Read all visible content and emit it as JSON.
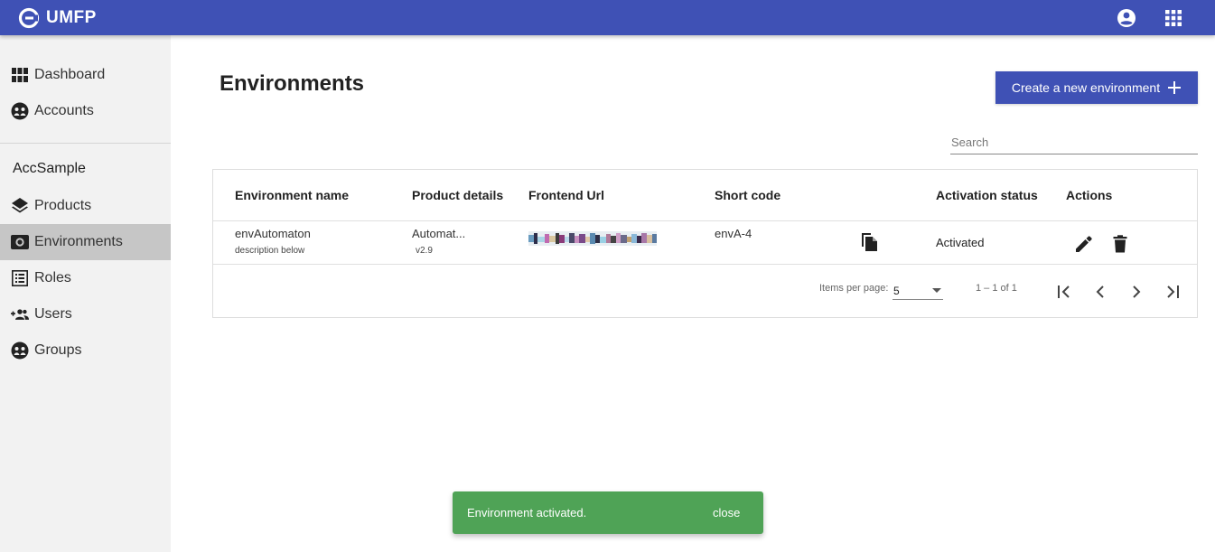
{
  "app": {
    "name": "UMFP"
  },
  "header": {
    "account_icon": "account-circle-icon",
    "apps_icon": "apps-grid-icon"
  },
  "sidebar": {
    "items": [
      {
        "label": "Dashboard",
        "icon": "dashboard-grid-icon"
      },
      {
        "label": "Accounts",
        "icon": "accounts-icon"
      }
    ],
    "section_label": "AccSample",
    "section_items": [
      {
        "label": "Products",
        "icon": "layers-icon"
      },
      {
        "label": "Environments",
        "icon": "camera-icon",
        "active": true
      },
      {
        "label": "Roles",
        "icon": "list-icon"
      },
      {
        "label": "Users",
        "icon": "group-add-icon"
      },
      {
        "label": "Groups",
        "icon": "groups-icon"
      }
    ]
  },
  "main": {
    "title": "Environments",
    "create_button_label": "Create a new environment",
    "search_placeholder": "Search",
    "table": {
      "headers": [
        "Environment name",
        "Product details",
        "Frontend Url",
        "Short code",
        "Activation status",
        "Actions"
      ],
      "rows": [
        {
          "name": "envAutomaton",
          "description": "description below",
          "product": "Automat...",
          "version": "v2.9",
          "frontend_url": "",
          "short_code": "envA-4",
          "status": "Activated"
        }
      ]
    },
    "pagination": {
      "items_per_page_label": "Items per page:",
      "items_per_page": "5",
      "range": "1 – 1 of 1"
    }
  },
  "snackbar": {
    "message": "Environment activated.",
    "action": "close",
    "color": "#4fa356"
  },
  "colors": {
    "primary": "#3f51b5",
    "sidebar_bg": "#f2f2f2",
    "active_item": "#c6c6c6"
  }
}
